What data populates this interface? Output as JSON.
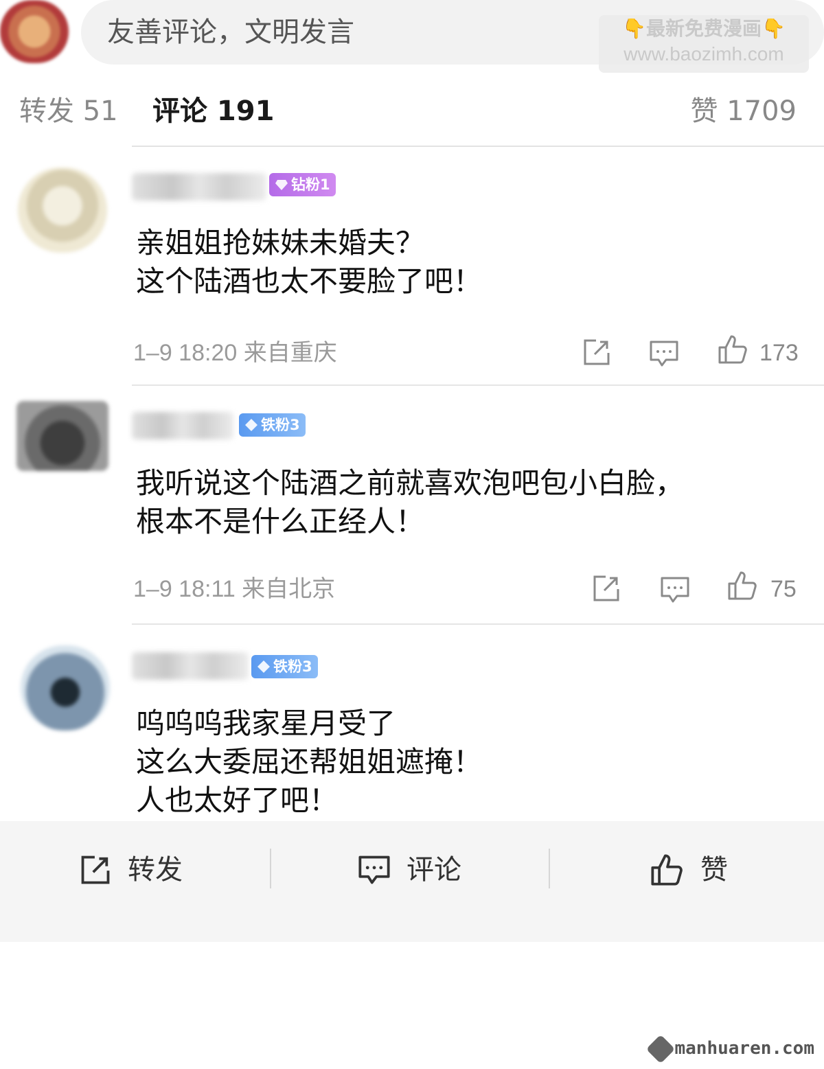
{
  "compose": {
    "placeholder": "友善评论，文明发言"
  },
  "watermark": {
    "line1": "👇最新免费漫画👇",
    "line2": "www.baozimh.com"
  },
  "tabs": {
    "forward": "转发 51",
    "comment": "评论 191",
    "like": "赞 1709"
  },
  "comments": [
    {
      "badge": "钻粉1",
      "badge_color": "#c07aeb",
      "lines": [
        "亲姐姐抢妹妹未婚夫？",
        "这个陆酒也太不要脸了吧！"
      ],
      "meta": "1–9 18:20  来自重庆",
      "likes": "173"
    },
    {
      "badge": "铁粉3",
      "badge_color": "#6ea7f3",
      "lines": [
        "我听说这个陆酒之前就喜欢泡吧包小白脸，",
        "根本不是什么正经人！"
      ],
      "meta": "1–9 18:11  来自北京",
      "likes": "75"
    },
    {
      "badge": "铁粉3",
      "badge_color": "#6ea7f3",
      "lines": [
        "呜呜呜我家星月受了",
        "这么大委屈还帮姐姐遮掩！",
        "人也太好了吧！"
      ]
    }
  ],
  "toolbar": {
    "forward": "转发",
    "comment": "评论",
    "like": "赞"
  },
  "logo": "manhuaren.com"
}
